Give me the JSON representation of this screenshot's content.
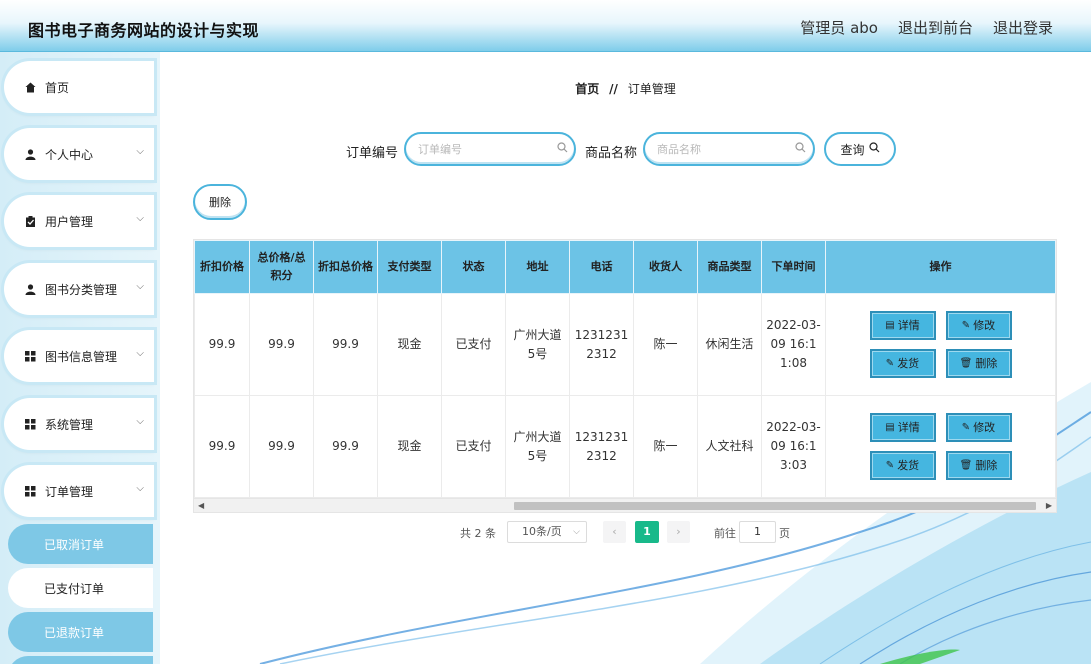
{
  "header": {
    "title": "图书电子商务网站的设计与实现",
    "nav": [
      "管理员 abo",
      "退出到前台",
      "退出登录"
    ]
  },
  "sidebar": {
    "items": [
      {
        "label": "首页",
        "icon": "home-icon",
        "has_chevron": false
      },
      {
        "label": "个人中心",
        "icon": "user-icon",
        "has_chevron": true
      },
      {
        "label": "用户管理",
        "icon": "clipboard-icon",
        "has_chevron": true
      },
      {
        "label": "图书分类管理",
        "icon": "user-icon",
        "has_chevron": true
      },
      {
        "label": "图书信息管理",
        "icon": "grid-icon",
        "has_chevron": true
      },
      {
        "label": "系统管理",
        "icon": "grid-icon",
        "has_chevron": true
      },
      {
        "label": "订单管理",
        "icon": "grid-icon",
        "has_chevron": true
      }
    ],
    "subitems": [
      {
        "label": "已取消订单",
        "style": "blue"
      },
      {
        "label": "已支付订单",
        "style": "white"
      },
      {
        "label": "已退款订单",
        "style": "blue"
      }
    ]
  },
  "breadcrumb": {
    "home": "首页",
    "sep": "//",
    "current": "订单管理"
  },
  "search": {
    "order_no_label": "订单编号",
    "order_no_placeholder": "订单编号",
    "product_label": "商品名称",
    "product_placeholder": "商品名称",
    "query_label": "查询"
  },
  "toolbar": {
    "delete_label": "删除"
  },
  "table": {
    "headers": [
      "折扣价格",
      "总价格/总积分",
      "折扣总价格",
      "支付类型",
      "状态",
      "地址",
      "电话",
      "收货人",
      "商品类型",
      "下单时间",
      "操作"
    ],
    "rows": [
      {
        "discount_price": "99.9",
        "total_price": "99.9",
        "discount_total": "99.9",
        "pay_type": "现金",
        "status": "已支付",
        "address": "广州大道5号",
        "phone": "12312312312",
        "receiver": "陈一",
        "category": "休闲生活",
        "order_time": "2022-03-09 16:11:08"
      },
      {
        "discount_price": "99.9",
        "total_price": "99.9",
        "discount_total": "99.9",
        "pay_type": "现金",
        "status": "已支付",
        "address": "广州大道5号",
        "phone": "12312312312",
        "receiver": "陈一",
        "category": "人文社科",
        "order_time": "2022-03-09 16:13:03"
      }
    ],
    "actions": {
      "detail": "详情",
      "edit": "修改",
      "ship": "发货",
      "delete": "删除"
    }
  },
  "pagination": {
    "total": "共 2 条",
    "page_size": "10条/页",
    "prev": "‹",
    "next": "›",
    "current_page": "1",
    "goto_label": "前往",
    "goto_value": "1",
    "page_unit": "页"
  },
  "colors": {
    "accent": "#4bb4dc",
    "header_bg": "#7fcdea",
    "active_page": "#18b98a",
    "table_header": "#6cc3e6"
  }
}
